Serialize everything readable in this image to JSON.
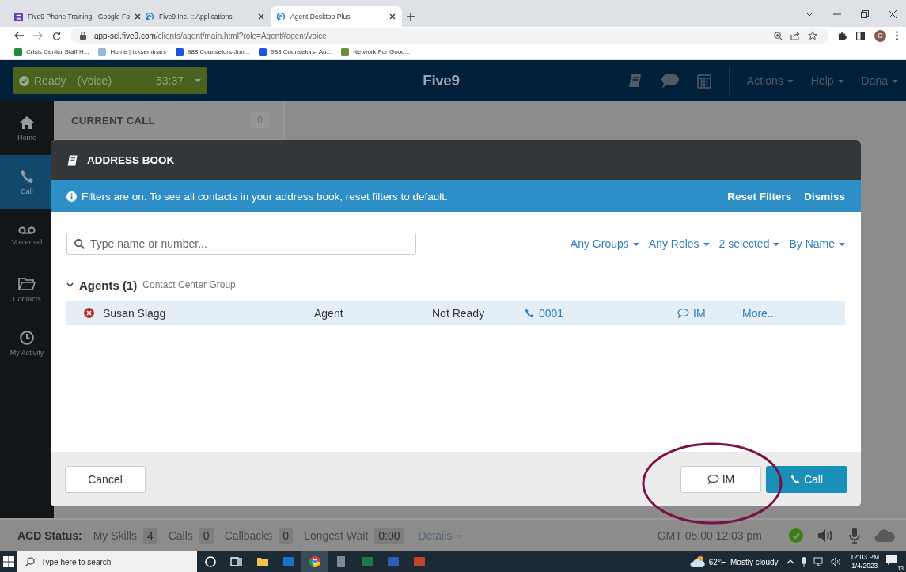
{
  "browser": {
    "tabs": [
      {
        "title": "Five9 Phone Training - Google Fo",
        "selected": false
      },
      {
        "title": "Five9 Inc. :: Applications",
        "selected": false
      },
      {
        "title": "Agent Desktop Plus",
        "selected": true
      }
    ],
    "url_host": "app-scl.five9.com",
    "url_path": "/clients/agent/main.html?role=Agent#agent/voice",
    "profile_initial": "C",
    "bookmarks": [
      "Crisis Center Staff H...",
      "Home | tzkseminars",
      "988 Counselors-Jun...",
      "988 Counselors- Au...",
      "Network For Good..."
    ]
  },
  "header": {
    "status": "Ready",
    "channel": "(Voice)",
    "timer": "53:37",
    "logo": "Five9",
    "menus": [
      "Actions",
      "Help",
      "Dana"
    ]
  },
  "sidebar": {
    "items": [
      {
        "label": "Home",
        "selected": false
      },
      {
        "label": "Call",
        "selected": true
      },
      {
        "label": "Voicemail",
        "selected": false
      },
      {
        "label": "Contacts",
        "selected": false
      },
      {
        "label": "My Activity",
        "selected": false
      }
    ]
  },
  "current_call": {
    "title": "CURRENT CALL",
    "count": "0"
  },
  "dialog": {
    "title": "ADDRESS BOOK",
    "banner": "Filters are on. To see all contacts in your address book, reset filters to default.",
    "banner_actions": [
      "Reset Filters",
      "Dismiss"
    ],
    "search": {
      "placeholder": "Type name or number..."
    },
    "filters": [
      "Any Groups",
      "Any Roles",
      "2 selected",
      "By Name"
    ],
    "group": {
      "name": "Agents",
      "count": "(1)",
      "subtitle": "Contact Center Group",
      "expanded": true
    },
    "contacts": [
      {
        "name": "Susan Slagg",
        "role": "Agent",
        "status": "Not Ready",
        "phone": "0001",
        "im": "IM",
        "more": "More..."
      }
    ],
    "cancel": "Cancel",
    "im_button": "IM",
    "call_button": "Call"
  },
  "acd": {
    "label": "ACD Status:",
    "stats": [
      {
        "label": "My Skills",
        "value": "4"
      },
      {
        "label": "Calls",
        "value": "0"
      },
      {
        "label": "Callbacks",
        "value": "0"
      },
      {
        "label": "Longest Wait",
        "value": "0:00"
      }
    ],
    "details": "Details",
    "time": "GMT-05:00 12:03 pm"
  },
  "taskbar": {
    "search_placeholder": "Type here to search",
    "weather_temp": "62°F",
    "weather_text": "Mostly cloudy",
    "time": "12:03 PM",
    "date": "1/4/2023",
    "notifications": "13"
  }
}
